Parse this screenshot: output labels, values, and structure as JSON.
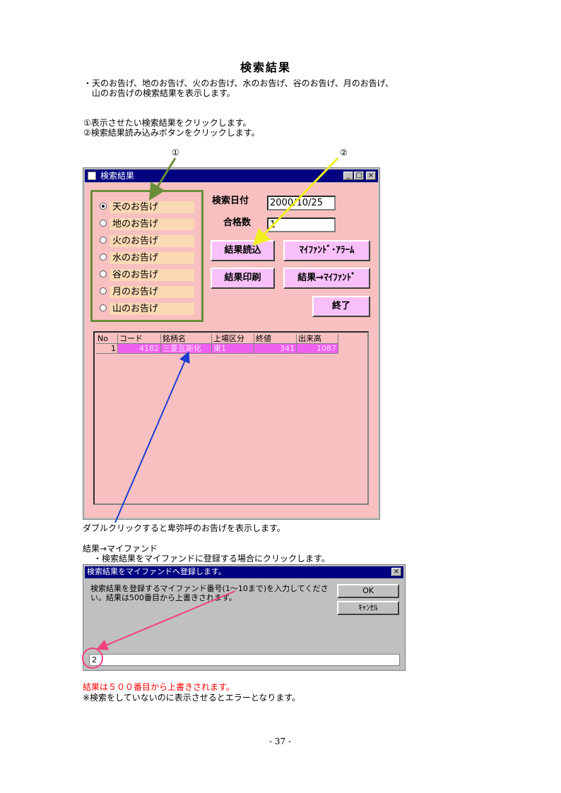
{
  "title": "検索結果",
  "intro": [
    "・天のお告げ、地のお告げ、火のお告げ、水のお告げ、谷のお告げ、月のお告げ、",
    "山のお告げの検索結果を表示します。"
  ],
  "steps": [
    "①表示させたい検索結果をクリックします。",
    "②検索結果読み込みボタンをクリックします。"
  ],
  "callouts": {
    "one": "①",
    "two": "②"
  },
  "window": {
    "title": "検索結果",
    "title_buttons": {
      "minimize": "_",
      "maximize": "□",
      "close": "×"
    },
    "radios": [
      {
        "label": "天のお告げ",
        "selected": true
      },
      {
        "label": "地のお告げ",
        "selected": false
      },
      {
        "label": "火のお告げ",
        "selected": false
      },
      {
        "label": "水のお告げ",
        "selected": false
      },
      {
        "label": "谷のお告げ",
        "selected": false
      },
      {
        "label": "月のお告げ",
        "selected": false
      },
      {
        "label": "山のお告げ",
        "selected": false
      }
    ],
    "search_date_label": "検索日付",
    "search_date_value": "2000/10/25",
    "pass_count_label": "合格数",
    "pass_count_value": "1",
    "buttons": {
      "load": "結果読込",
      "myfund_alarm": "ﾏｲﾌｧﾝﾄﾞ･ｱﾗｰﾑ",
      "print": "結果印刷",
      "to_myfund": "結果→ﾏｲﾌｧﾝﾄﾞ",
      "exit": "終了"
    },
    "grid": {
      "headers": [
        "No",
        "コード",
        "銘柄名",
        "上場区分",
        "終値",
        "出来高"
      ],
      "rows": [
        [
          "1",
          "4182",
          "三菱瓦斯化",
          "東1",
          "341",
          "1087"
        ]
      ]
    }
  },
  "note_doubleclick": "ダブルクリックすると卑弥呼のお告げを表示します。",
  "section2": {
    "heading": "結果→マイファンド",
    "desc": "・検索結果をマイファンドに登録する場合にクリックします。"
  },
  "dialog": {
    "title": "検索結果をマイファンドへ登録します。",
    "close": "×",
    "message": "検索結果を登録するマイファンド番号(1～10まで)を入力してください。結果は500番目から上書きされます。",
    "ok": "OK",
    "cancel": "ｷｬﾝｾﾙ",
    "input_value": "2"
  },
  "footer_red": "結果は５００番目から上書きされます。",
  "footer_note": "※検索をしていないのに表示させるとエラーとなります。",
  "page_number": "- 37 -",
  "colors": {
    "window_bg": "#f8c0c0",
    "button_bg": "#f8c0f8",
    "radio_label_bg": "#fad9b5",
    "group_border": "#6b8e3a",
    "row_highlight": "#f060f0",
    "arrow_green": "#6b8e3a",
    "arrow_yellow": "#f0f020",
    "arrow_blue": "#1a3fd0",
    "arrow_pink": "#f04080"
  }
}
